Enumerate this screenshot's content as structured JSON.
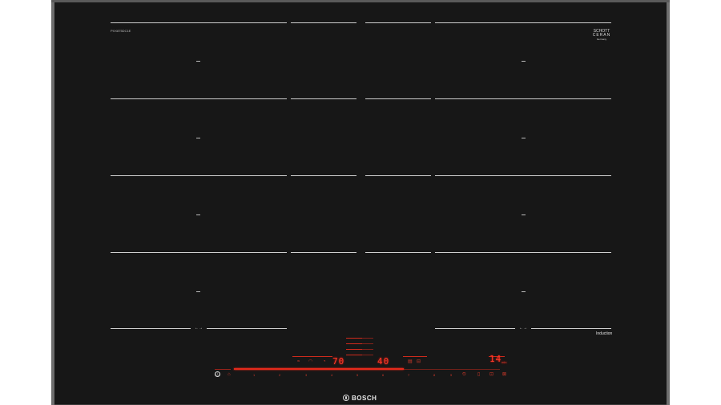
{
  "labels": {
    "model_code": "PXX875DC1E",
    "brand_line1": "SCHOTT",
    "brand_line2": "CERAN",
    "brand_line3": "Germany",
    "flex_left": "←→",
    "flex_right": "←→",
    "technology": "Induction",
    "logo": "BOSCH"
  },
  "display": {
    "left_level": "70",
    "center_level": "40",
    "timer": "14",
    "timer_unit": "min"
  },
  "control_row": {
    "power_symbol": "ⓘ",
    "keys": [
      "1",
      "2",
      "3",
      "4",
      "5",
      "6",
      "7",
      "8",
      "9"
    ]
  },
  "icons": [
    "power-icon",
    "child-lock-icon",
    "timer-icon",
    "wifi-icon",
    "hood-icon",
    "pan-icon"
  ]
}
